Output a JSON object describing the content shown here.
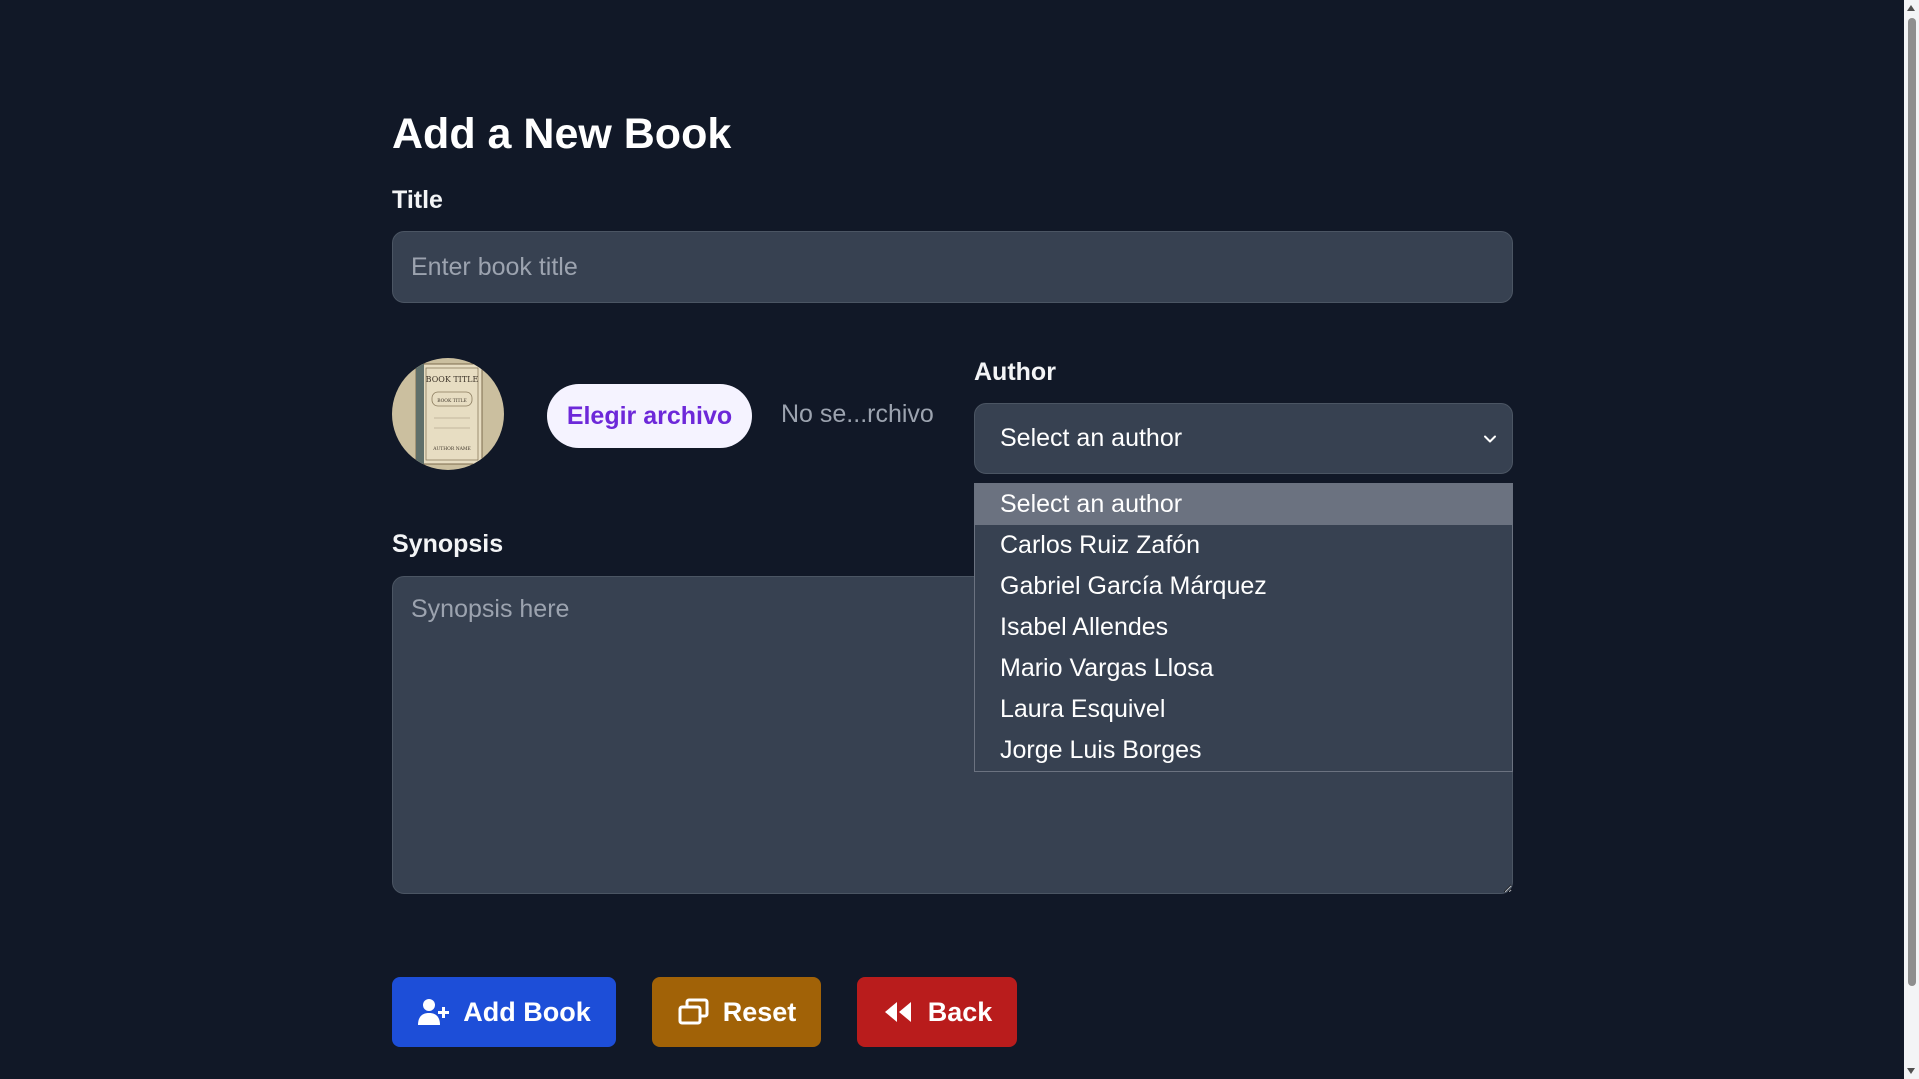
{
  "page": {
    "title": "Add a New Book"
  },
  "form": {
    "title_label": "Title",
    "title_placeholder": "Enter book title",
    "file_button_label": "Elegir archivo",
    "file_name_text": "No se...rchivo",
    "author_label": "Author",
    "author_selected": "Select an author",
    "author_options": [
      "Select an author",
      "Carlos Ruiz Zafón",
      "Gabriel García Márquez",
      "Isabel Allendes",
      "Mario Vargas Llosa",
      "Laura Esquivel",
      "Jorge Luis Borges"
    ],
    "synopsis_label": "Synopsis",
    "synopsis_placeholder": "Synopsis here"
  },
  "cover": {
    "title_text": "BOOK TITLE",
    "subtitle_text": "BOOK TITLE",
    "author_text": "AUTHOR NAME"
  },
  "actions": {
    "add_label": "Add Book",
    "reset_label": "Reset",
    "back_label": "Back"
  },
  "colors": {
    "background": "#111827",
    "input_bg": "#374151",
    "add_button": "#1d4ed8",
    "reset_button": "#a16207",
    "back_button": "#b91c1c",
    "file_button_text": "#6d28d9"
  },
  "icons": {
    "cover": "book-cover-image",
    "add": "user-plus-icon",
    "reset": "window-restore-icon",
    "back": "backward-icon",
    "select": "chevron-down-icon"
  }
}
